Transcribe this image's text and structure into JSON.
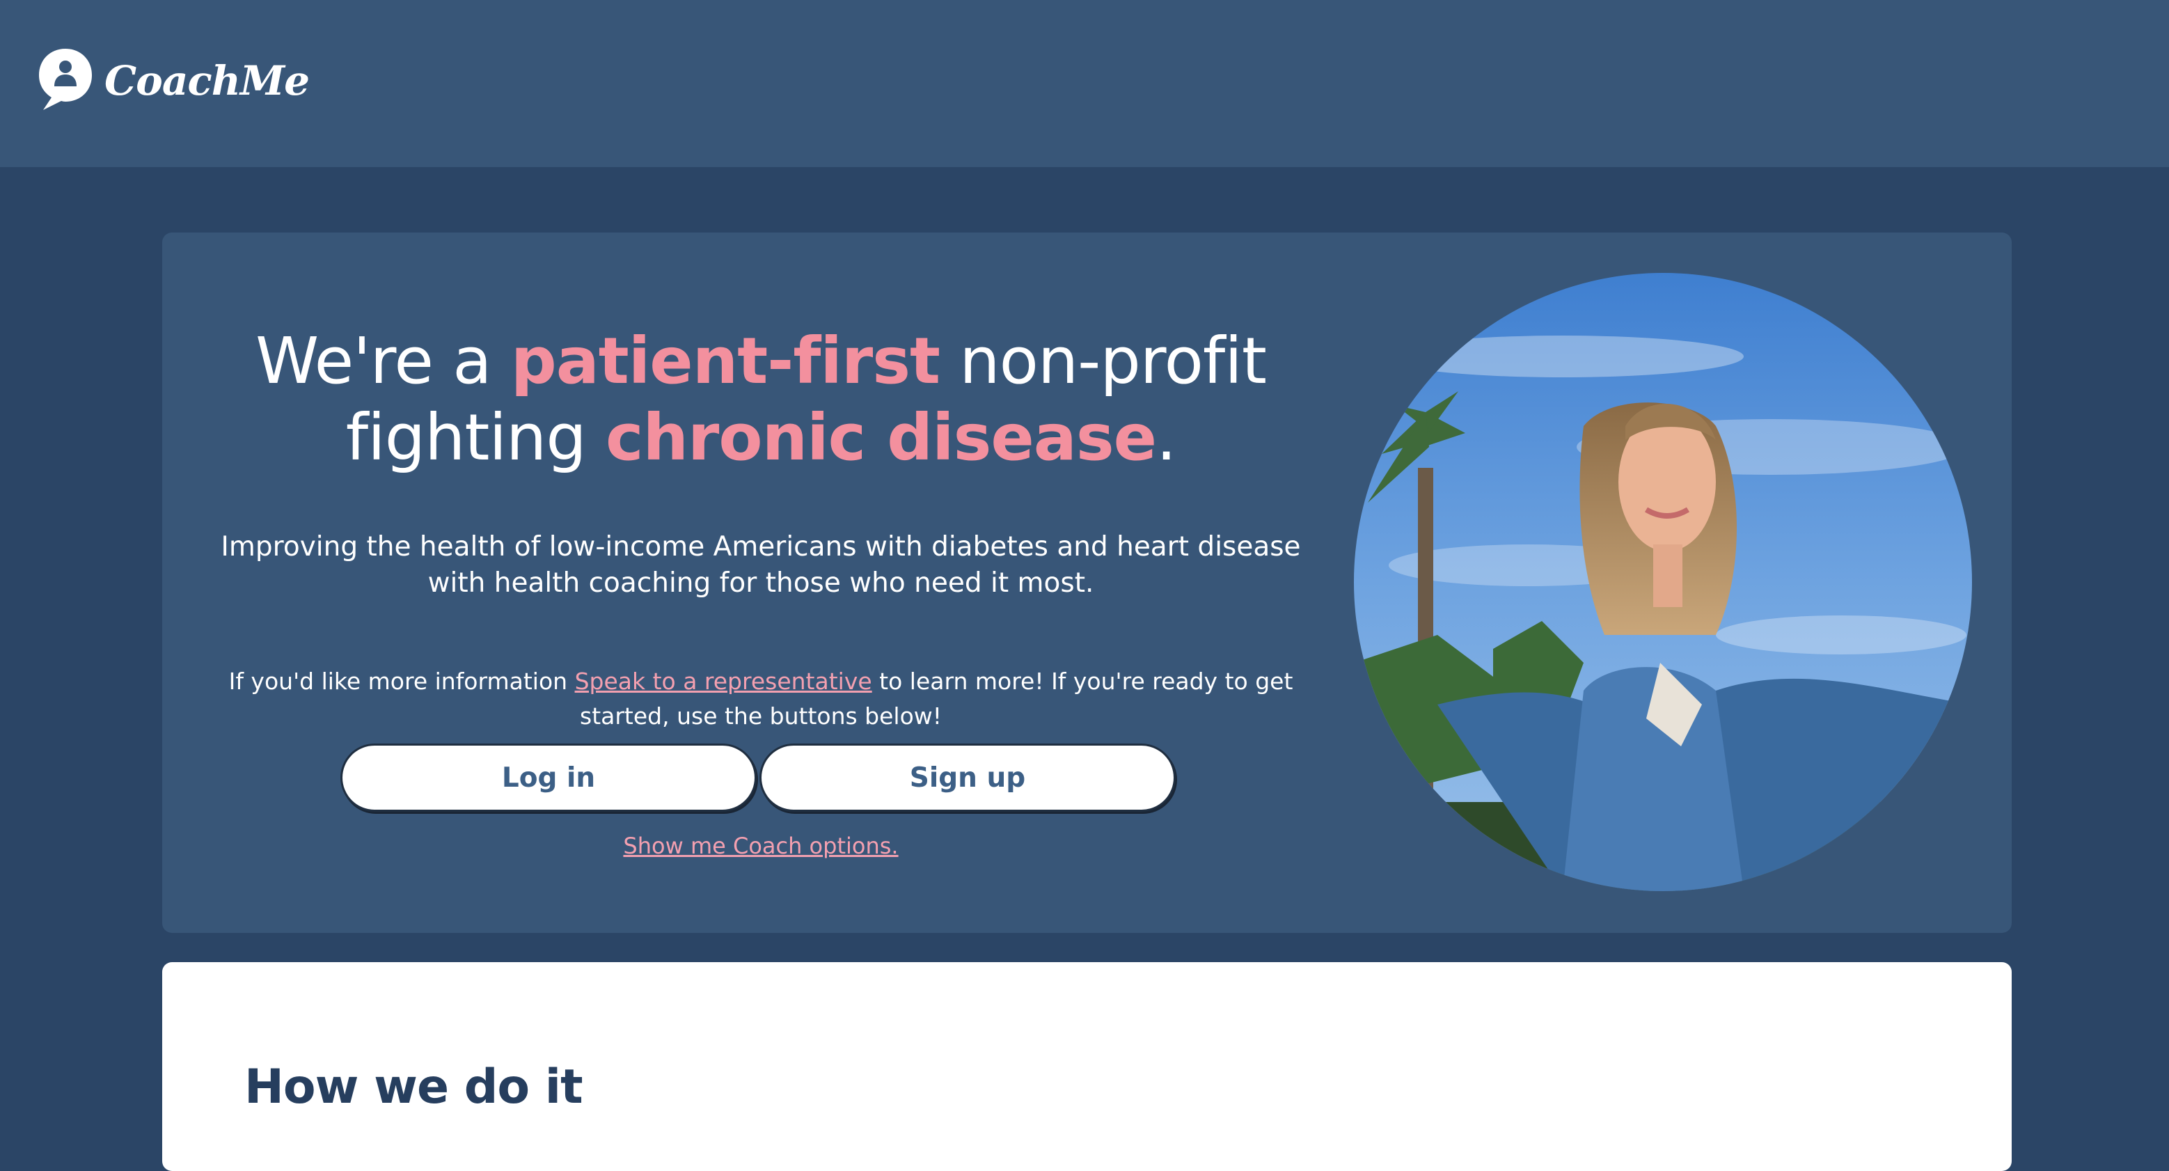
{
  "header": {
    "logo_text": "CoachMe",
    "logo_icon": "speech-bubble-person-icon",
    "background": "#385678"
  },
  "hero": {
    "headline": {
      "part1": "We're a ",
      "highlight1": "patient-first",
      "part2": " non-profit",
      "part3": "fighting ",
      "highlight2": "chronic disease",
      "part4": "."
    },
    "subtext": "Improving the health of low-income Americans with diabetes and heart disease with health coaching for those who need it most.",
    "info": {
      "before": "If you'd like more information ",
      "link": "Speak to a representative",
      "after": " to learn more! If you're ready to get started, use the buttons below!"
    },
    "login_label": "Log in",
    "signup_label": "Sign up",
    "coach_link": "Show me Coach options.",
    "image": "woman-arms-outstretched-photo"
  },
  "how": {
    "title": "How we do it"
  },
  "colors": {
    "page_bg": "#2b4566",
    "card_bg": "#385678",
    "accent_pink": "#f3909e",
    "button_text": "#3c5f86",
    "heading_dark": "#263e5e"
  }
}
